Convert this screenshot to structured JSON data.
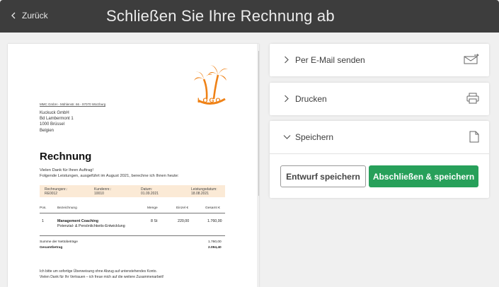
{
  "header": {
    "back_label": "Zurück",
    "title": "Schließen Sie Ihre Rechnung ab"
  },
  "invoice": {
    "logo_text": "LOGO",
    "sender_line": "MMC GmbH - Mühlenstr. 66 - 97070 Würzburg",
    "recipient": [
      "Kuckuck GmbH",
      "Bd Lambermont 1",
      "1000 Brüssel",
      "Belgien"
    ],
    "title": "Rechnung",
    "thanks_1": "Vielen Dank für Ihren Auftrag!",
    "thanks_2": "Folgende Leistungen, ausgeführt im August 2021, berechne ich Ihnen heute:",
    "meta": {
      "invoice_no_label": "Rechnungsnr.:",
      "invoice_no": "RE0012",
      "customer_no_label": "Kundennr.:",
      "customer_no": "10010",
      "date_label": "Datum:",
      "date": "01.09.2021",
      "service_date_label": "Leistungsdatum:",
      "service_date": "18.08.2021"
    },
    "columns": {
      "pos": "Pos.",
      "description": "Bezeichnung",
      "qty": "Menge",
      "unit_price": "Einzel €",
      "total": "Gesamt €"
    },
    "item": {
      "pos": "1",
      "name": "Management Coaching",
      "detail": "Potenzial- & Persönlichkeits-Entwicklung",
      "qty": "8 St",
      "unit_price": "220,00",
      "total": "1.760,00"
    },
    "net_label": "Summe der Nettobeträge",
    "net_value": "1.760,00",
    "gross_label": "Gesamtbetrag",
    "gross_value": "2.094,40",
    "footer_1": "Ich bitte um sofortige Überweisung ohne Abzug auf untenstehendes Konto.",
    "footer_2": "Vielen Dank für Ihr Vertrauen – ich freue mich auf die weitere Zusammenarbeit!"
  },
  "actions": {
    "email_label": "Per E-Mail senden",
    "print_label": "Drucken",
    "save_label": "Speichern",
    "draft_button": "Entwurf speichern",
    "finalize_button": "Abschließen & speichern"
  },
  "colors": {
    "topbar": "#3d3d3d",
    "accent_green": "#27a05a",
    "logo_orange": "#ef8217"
  },
  "icons": [
    "chevron-left-icon",
    "chevron-right-icon",
    "chevron-down-icon",
    "envelope-icon",
    "printer-icon",
    "document-icon",
    "palm-tree-logo"
  ]
}
